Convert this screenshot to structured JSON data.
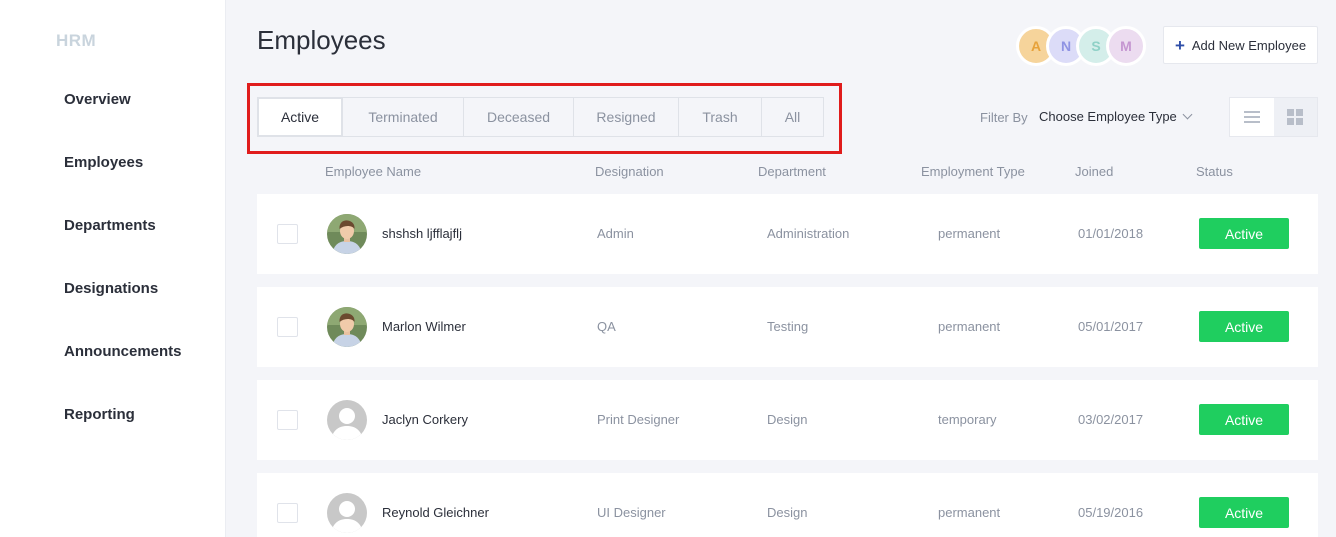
{
  "sidebar": {
    "brand": "HRM",
    "items": [
      {
        "label": "Overview"
      },
      {
        "label": "Employees"
      },
      {
        "label": "Departments"
      },
      {
        "label": "Designations"
      },
      {
        "label": "Announcements"
      },
      {
        "label": "Reporting"
      }
    ]
  },
  "header": {
    "title": "Employees",
    "avatars": [
      {
        "initial": "A",
        "bg": "#f6d49b",
        "color": "#e7a23a"
      },
      {
        "initial": "N",
        "bg": "#dcdcf8",
        "color": "#8f93e3"
      },
      {
        "initial": "S",
        "bg": "#d4eeea",
        "color": "#8fd1c7"
      },
      {
        "initial": "M",
        "bg": "#ecdcf0",
        "color": "#c596d1"
      }
    ],
    "add_button": {
      "icon": "plus-icon",
      "label": "Add New Employee"
    }
  },
  "tabs": [
    {
      "label": "Active",
      "active": true
    },
    {
      "label": "Terminated"
    },
    {
      "label": "Deceased"
    },
    {
      "label": "Resigned"
    },
    {
      "label": "Trash"
    },
    {
      "label": "All"
    }
  ],
  "filter": {
    "label": "Filter By",
    "value": "Choose Employee Type"
  },
  "view_toggle": {
    "list_icon": "list-view-icon",
    "grid_icon": "grid-view-icon"
  },
  "table": {
    "columns": [
      "Employee Name",
      "Designation",
      "Department",
      "Employment Type",
      "Joined",
      "Status"
    ],
    "rows": [
      {
        "name": "shshsh ljfflajflj",
        "designation": "Admin",
        "department": "Administration",
        "type": "permanent",
        "joined": "01/01/2018",
        "status": "Active",
        "avatar": "photo"
      },
      {
        "name": "Marlon Wilmer",
        "designation": "QA",
        "department": "Testing",
        "type": "permanent",
        "joined": "05/01/2017",
        "status": "Active",
        "avatar": "photo"
      },
      {
        "name": "Jaclyn Corkery",
        "designation": "Print Designer",
        "department": "Design",
        "type": "temporary",
        "joined": "03/02/2017",
        "status": "Active",
        "avatar": "placeholder"
      },
      {
        "name": "Reynold Gleichner",
        "designation": "UI Designer",
        "department": "Design",
        "type": "permanent",
        "joined": "05/19/2016",
        "status": "Active",
        "avatar": "placeholder"
      }
    ]
  },
  "colors": {
    "status_active": "#1fce5f",
    "accent": "#2e4ea8",
    "highlight": "#e01c1c"
  }
}
